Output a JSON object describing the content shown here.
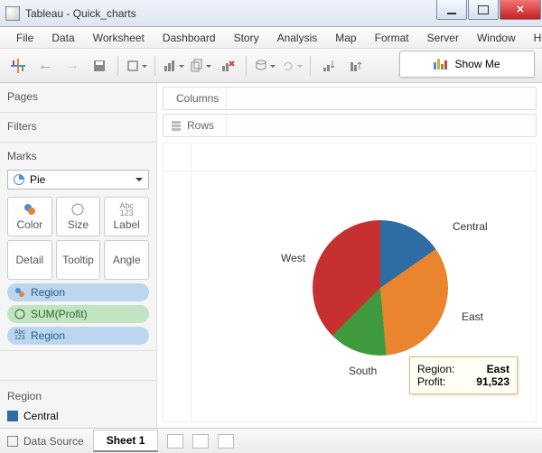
{
  "window": {
    "title": "Tableau - Quick_charts"
  },
  "menu": {
    "items": [
      "File",
      "Data",
      "Worksheet",
      "Dashboard",
      "Story",
      "Analysis",
      "Map",
      "Format",
      "Server",
      "Window",
      "Help"
    ]
  },
  "toolbar": {
    "showme": "Show Me"
  },
  "panels": {
    "pages": "Pages",
    "filters": "Filters",
    "marks": "Marks"
  },
  "marks": {
    "type": "Pie",
    "buttons": {
      "color": "Color",
      "size": "Size",
      "label": "Label",
      "detail": "Detail",
      "tooltip": "Tooltip",
      "angle": "Angle"
    },
    "pills": [
      {
        "type": "blue",
        "icon": "color",
        "label": "Region"
      },
      {
        "type": "green",
        "icon": "size",
        "label": "SUM(Profit)"
      },
      {
        "type": "blue",
        "icon": "label",
        "label": "Region"
      }
    ]
  },
  "region_card": {
    "title": "Region",
    "item": "Central"
  },
  "shelves": {
    "columns": "Columns",
    "rows": "Rows"
  },
  "chart_data": {
    "type": "pie",
    "title": "",
    "series": [
      {
        "name": "Central",
        "value_deg": 55,
        "color": "#2e6ca4"
      },
      {
        "name": "East",
        "value_deg": 120,
        "color": "#e8852e"
      },
      {
        "name": "South",
        "value_deg": 50,
        "color": "#3f9a3f"
      },
      {
        "name": "West",
        "value_deg": 135,
        "color": "#c73030"
      }
    ],
    "labels": [
      "Central",
      "East",
      "South",
      "West"
    ]
  },
  "tooltip": {
    "rows": [
      {
        "k": "Region:",
        "v": "East"
      },
      {
        "k": "Profit:",
        "v": "91,523"
      }
    ]
  },
  "bottom": {
    "datasource": "Data Source",
    "sheet": "Sheet 1"
  }
}
